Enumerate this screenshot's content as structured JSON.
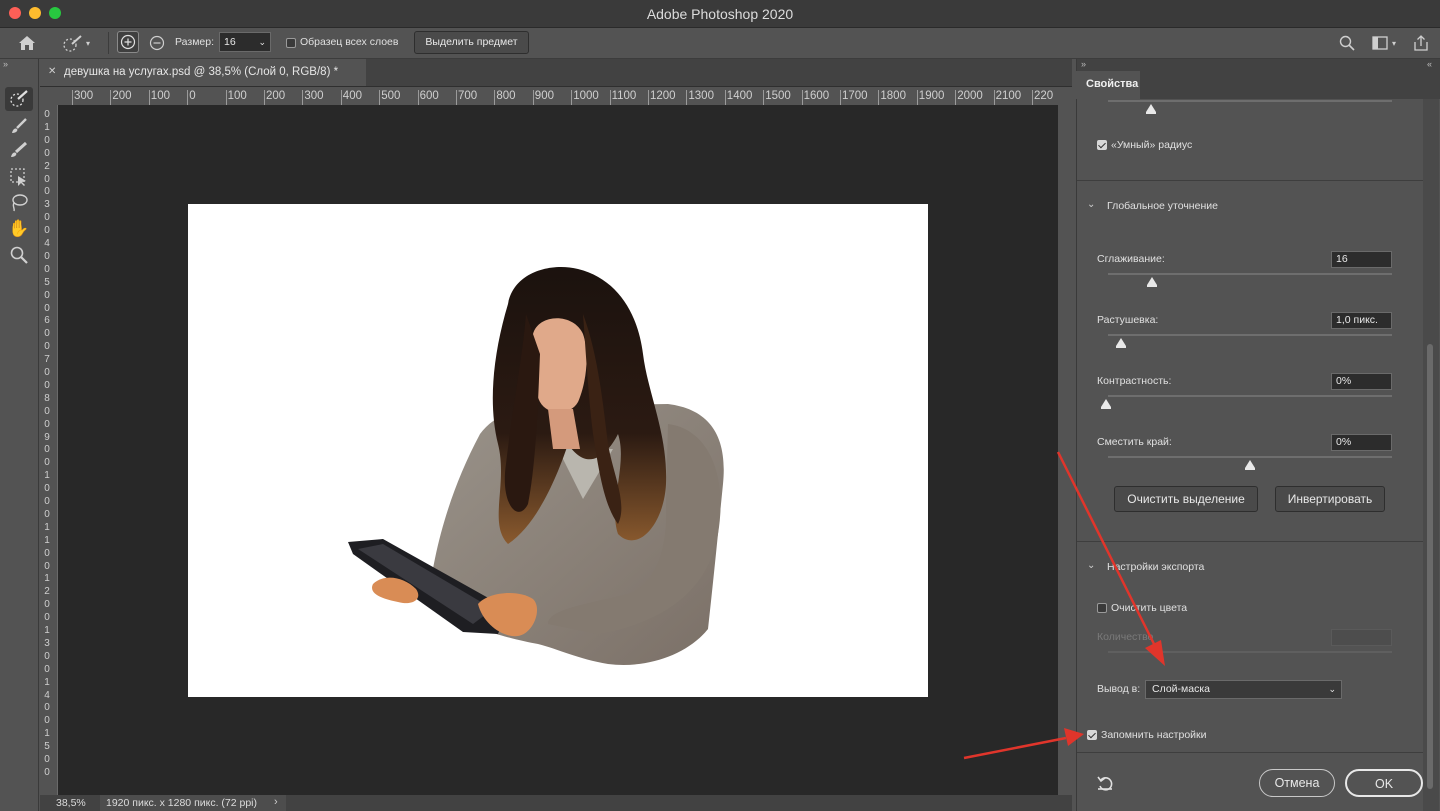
{
  "window": {
    "title": "Adobe Photoshop 2020"
  },
  "options_bar": {
    "size_label": "Размер:",
    "size_value": "16",
    "sample_all_label": "Образец всех слоев",
    "select_subject_label": "Выделить предмет"
  },
  "document": {
    "tab_title": "девушка на услугах.psd @ 38,5% (Слой 0, RGB/8) *",
    "zoom": "38,5%",
    "info": "1920 пикс. x 1280 пикс. (72 ppi)"
  },
  "ruler": {
    "h_ticks": [
      "300",
      "200",
      "100",
      "0",
      "100",
      "200",
      "300",
      "400",
      "500",
      "600",
      "700",
      "800",
      "900",
      "1000",
      "1100",
      "1200",
      "1300",
      "1400",
      "1500",
      "1600",
      "1700",
      "1800",
      "1900",
      "2000",
      "2100",
      "220"
    ],
    "v_ticks": [
      "0",
      "1",
      "0",
      "0",
      "2",
      "0",
      "0",
      "3",
      "0",
      "0",
      "4",
      "0",
      "0",
      "5",
      "0",
      "0",
      "6",
      "0",
      "0",
      "7",
      "0",
      "0",
      "8",
      "0",
      "0",
      "9",
      "0",
      "0",
      "1",
      "0",
      "0",
      "0",
      "1",
      "1",
      "0",
      "0",
      "1",
      "2",
      "0",
      "0",
      "1",
      "3",
      "0",
      "0",
      "1",
      "4",
      "0",
      "0",
      "1",
      "5",
      "0",
      "0"
    ]
  },
  "panel": {
    "tab_label": "Свойства",
    "smart_radius_label": "«Умный» радиус",
    "smart_radius_checked": true,
    "global_refine_header": "Глобальное уточнение",
    "smooth_label": "Сглаживание:",
    "smooth_value": "16",
    "feather_label": "Растушевка:",
    "feather_value": "1,0 пикс.",
    "contrast_label": "Контрастность:",
    "contrast_value": "0%",
    "shift_edge_label": "Сместить край:",
    "shift_edge_value": "0%",
    "clear_selection_label": "Очистить выделение",
    "invert_label": "Инвертировать",
    "export_header": "Настройки экспорта",
    "decontaminate_label": "Очистить цвета",
    "decontaminate_checked": false,
    "amount_label": "Количество",
    "output_label": "Вывод в:",
    "output_value": "Слой-маска",
    "remember_label": "Запомнить настройки",
    "remember_checked": true,
    "cancel_label": "Отмена",
    "ok_label": "OK"
  },
  "colors": {
    "annotation_arrow": "#e0352b",
    "panel_bg": "#535353",
    "canvas_bg": "#282828"
  }
}
